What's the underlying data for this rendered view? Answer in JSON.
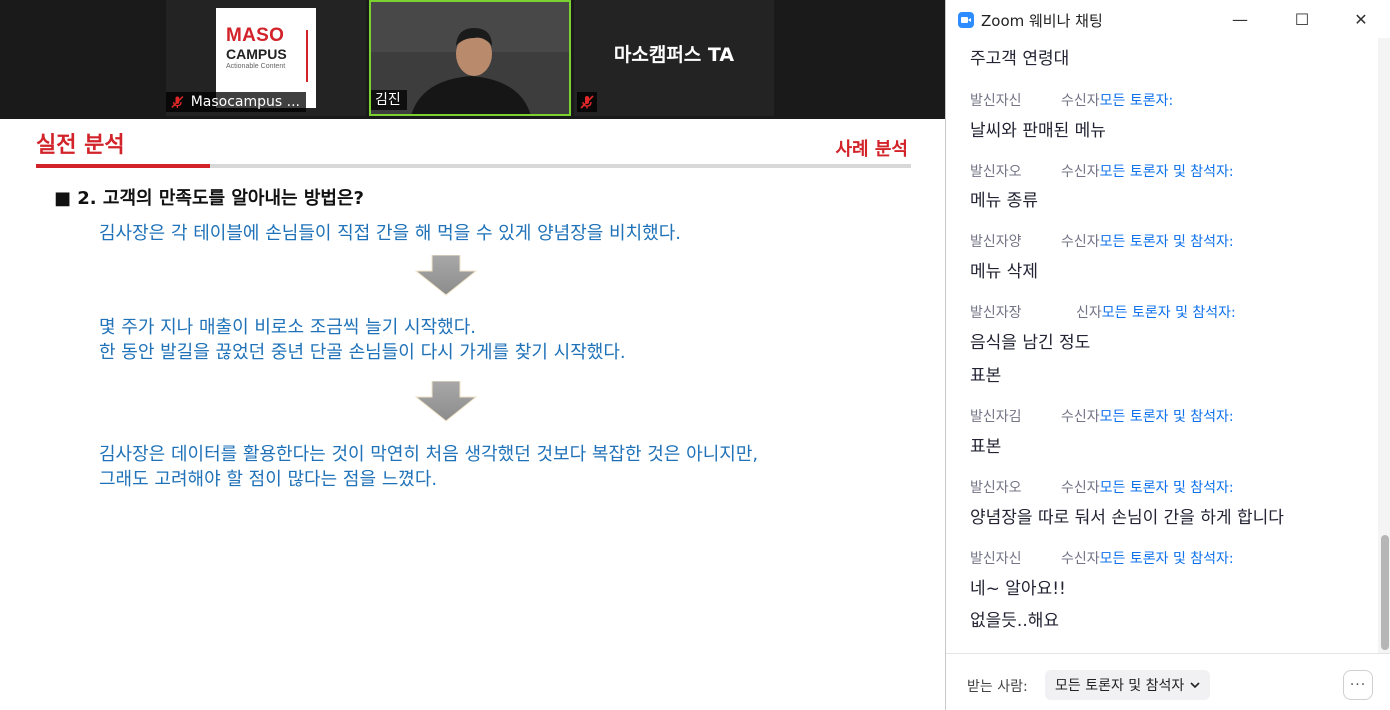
{
  "video": {
    "participants": [
      {
        "name": "Masocampus ...",
        "muted": true
      },
      {
        "name": "김진",
        "muted": false
      },
      {
        "name": "마소캠퍼스 TA",
        "muted": true
      }
    ],
    "logo": {
      "line1": "MASO",
      "line2": "CAMPUS",
      "line3": "Actionable Content"
    }
  },
  "slide": {
    "title": "실전 분석",
    "subtitle": "사례 분석",
    "question": "■ 2. 고객의 만족도를 알아내는 방법은?",
    "paragraphs": [
      {
        "lines": [
          "김사장은 각 테이블에 손님들이 직접 간을 해 먹을 수 있게 양념장을 비치했다."
        ]
      },
      {
        "lines": [
          "몇 주가 지나 매출이 비로소 조금씩 늘기 시작했다.",
          "한 동안 발길을 끊었던 중년 단골 손님들이 다시 가게를 찾기 시작했다."
        ]
      },
      {
        "lines": [
          "김사장은 데이터를 활용한다는 것이 막연히 처음 생각했던 것보다 복잡한 것은 아니지만,",
          "그래도 고려해야 할 점이 많다는 점을 느꼈다."
        ]
      }
    ],
    "colors": {
      "accent": "#d2232a",
      "body_text": "#1f72b8",
      "arrow": "#9e9e9e"
    }
  },
  "chat": {
    "window_title": "Zoom 웨비나 채팅",
    "controls": {
      "minimize": "—",
      "maximize": "☐",
      "close": "✕"
    },
    "messages": [
      {
        "text": "주고객 연령대"
      },
      {
        "sender": "발신자신",
        "to_prefix": "수신자",
        "to": "모든 토론자:",
        "text": "날씨와 판매된 메뉴"
      },
      {
        "sender": "발신자오",
        "to_prefix": "수신자",
        "to": "모든 토론자 및 참석자:",
        "text": "메뉴 종류"
      },
      {
        "sender": "발신자양",
        "to_prefix": "수신자",
        "to": "모든 토론자 및 참석자:",
        "text": "메뉴 삭제"
      },
      {
        "sender": "발신자장",
        "to_prefix": "신자",
        "to": "모든 토론자 및 참석자:",
        "text": "음식을 남긴 정도"
      },
      {
        "text": "표본"
      },
      {
        "sender": "발신자김",
        "to_prefix": "수신자",
        "to": "모든 토론자 및 참석자:",
        "text": "표본"
      },
      {
        "sender": "발신자오",
        "to_prefix": "수신자",
        "to": "모든 토론자 및 참석자:",
        "text": "양념장을 따로 둬서 손님이 간을 하게 합니다"
      },
      {
        "sender": "발신자신",
        "to_prefix": "수신자",
        "to": "모든 토론자 및 참석자:",
        "text": "네~ 알아요!!"
      },
      {
        "text": "없을듯..해요"
      }
    ],
    "footer": {
      "to_label": "받는 사람:",
      "recipient": "모든 토론자 및 참석자",
      "more": "···"
    },
    "colors": {
      "recipient_blue": "#0e71eb",
      "sender_grey": "#747487",
      "zoom_blue": "#2d8cff"
    }
  }
}
